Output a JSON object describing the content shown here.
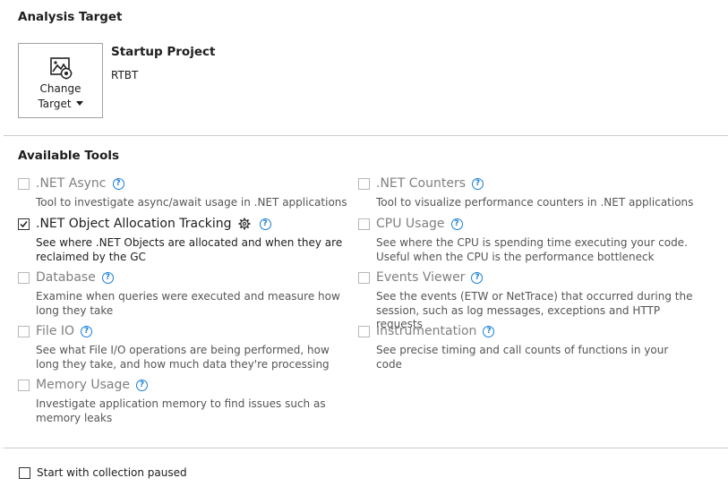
{
  "analysis_target": {
    "heading": "Analysis Target",
    "change_target_line1": "Change",
    "change_target_line2": "Target",
    "project_type": "Startup Project",
    "project_name": "RTBT"
  },
  "available_tools": {
    "heading": "Available Tools",
    "items": [
      {
        "name": ".NET Async",
        "description": "Tool to investigate async/await usage in .NET applications",
        "checked": false,
        "has_settings": false
      },
      {
        "name": ".NET Object Allocation Tracking",
        "description": "See where .NET Objects are allocated and when they are reclaimed by the GC",
        "checked": true,
        "has_settings": true
      },
      {
        "name": "Database",
        "description": "Examine when queries were executed and measure how long they take",
        "checked": false,
        "has_settings": false
      },
      {
        "name": "File IO",
        "description": "See what File I/O operations are being performed, how long they take, and how much data they're processing",
        "checked": false,
        "has_settings": false
      },
      {
        "name": "Memory Usage",
        "description": "Investigate application memory to find issues such as memory leaks",
        "checked": false,
        "has_settings": false
      },
      {
        "name": ".NET Counters",
        "description": "Tool to visualize performance counters in .NET applications",
        "checked": false,
        "has_settings": false
      },
      {
        "name": "CPU Usage",
        "description": "See where the CPU is spending time executing your code. Useful when the CPU is the performance bottleneck",
        "checked": false,
        "has_settings": false
      },
      {
        "name": "Events Viewer",
        "description": "See the events (ETW or NetTrace) that occurred during the session, such as log messages, exceptions and HTTP requests",
        "checked": false,
        "has_settings": false
      },
      {
        "name": "Instrumentation",
        "description": "See precise timing and call counts of functions in your code",
        "checked": false,
        "has_settings": false
      }
    ]
  },
  "footer": {
    "start_paused_label": "Start with collection paused",
    "start_paused_checked": false
  },
  "colors": {
    "help_icon": "#1a7fd4",
    "disabled_text": "#808080",
    "divider": "#cccccc"
  }
}
